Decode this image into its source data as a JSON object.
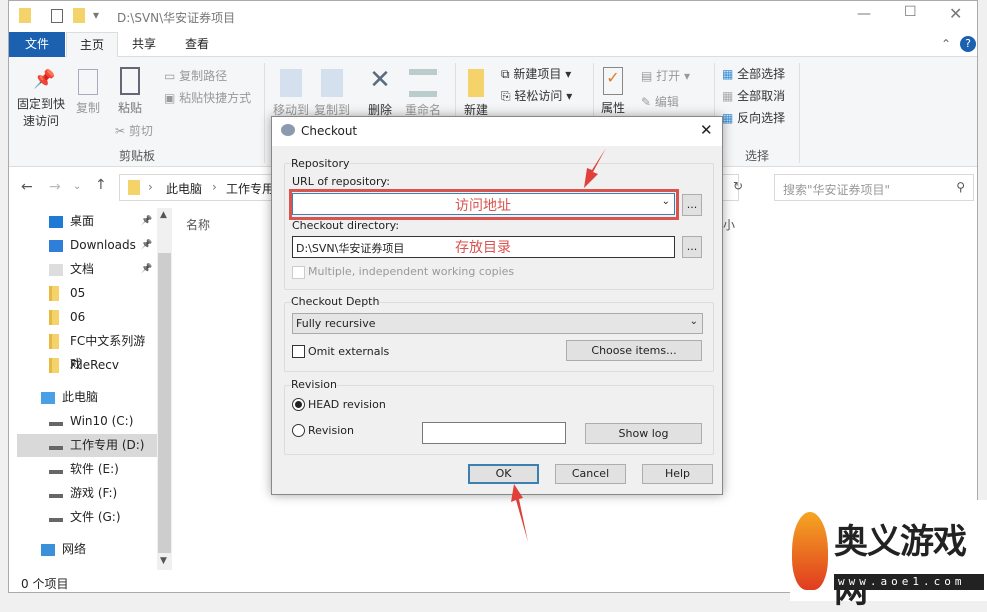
{
  "window": {
    "title": "D:\\SVN\\华安证券项目"
  },
  "tabs": [
    "文件",
    "主页",
    "共享",
    "查看"
  ],
  "ribbon": {
    "pin": "固定到快速访问",
    "copy": "复制",
    "paste": "粘贴",
    "copy_path": "复制路径",
    "paste_shortcut": "粘贴快捷方式",
    "cut": "剪切",
    "clipboard_group": "剪贴板",
    "move_to": "移动到",
    "copy_to": "复制到",
    "delete": "删除",
    "rename": "重命名",
    "new_folder": "新建",
    "new_item": "新建项目",
    "easy_access": "轻松访问",
    "properties": "属性",
    "open": "打开",
    "edit": "编辑",
    "select_all": "全部选择",
    "select_none": "全部取消",
    "invert": "反向选择",
    "select_group": "选择"
  },
  "address": {
    "crumbs": [
      "此电脑",
      "工作专用"
    ]
  },
  "search": {
    "placeholder": "搜索\"华安证券项目\""
  },
  "columns": {
    "name": "名称",
    "size": "小"
  },
  "nav": [
    {
      "label": "桌面",
      "icon": "desktop-icon",
      "pinned": true
    },
    {
      "label": "Downloads",
      "icon": "download-icon",
      "pinned": true
    },
    {
      "label": "文档",
      "icon": "document-icon",
      "pinned": true
    },
    {
      "label": "05",
      "icon": "folder-icon"
    },
    {
      "label": "06",
      "icon": "folder-icon"
    },
    {
      "label": "FC中文系列游戏",
      "icon": "folder-icon"
    },
    {
      "label": "FileRecv",
      "icon": "folder-icon"
    },
    {
      "label": "此电脑",
      "icon": "computer-icon"
    },
    {
      "label": "Win10 (C:)",
      "icon": "drive-icon"
    },
    {
      "label": "工作专用 (D:)",
      "icon": "drive-icon",
      "selected": true
    },
    {
      "label": "软件 (E:)",
      "icon": "drive-icon"
    },
    {
      "label": "游戏 (F:)",
      "icon": "drive-icon"
    },
    {
      "label": "文件 (G:)",
      "icon": "drive-icon"
    },
    {
      "label": "网络",
      "icon": "network-icon"
    }
  ],
  "status": {
    "count": "0 个项目"
  },
  "dialog": {
    "title": "Checkout",
    "repository_legend": "Repository",
    "url_label": "URL of repository:",
    "url_value": "",
    "dir_label": "Checkout directory:",
    "dir_value": "D:\\SVN\\华安证券项目",
    "browse": "...",
    "multiple": "Multiple, independent working copies",
    "depth_legend": "Checkout Depth",
    "depth_value": "Fully recursive",
    "omit": "Omit externals",
    "choose": "Choose items...",
    "revision_legend": "Revision",
    "head": "HEAD revision",
    "revision": "Revision",
    "revision_value": "",
    "show_log": "Show log",
    "ok": "OK",
    "cancel": "Cancel",
    "help": "Help"
  },
  "annotations": {
    "url": "访问地址",
    "dir": "存放目录",
    "highlight_color": "#d9534f"
  },
  "watermark": {
    "name": "奥义游戏网",
    "url": "www.aoe1.com"
  },
  "colors": {
    "file_tab": "#1b61b0",
    "accent": "#0078d7"
  }
}
